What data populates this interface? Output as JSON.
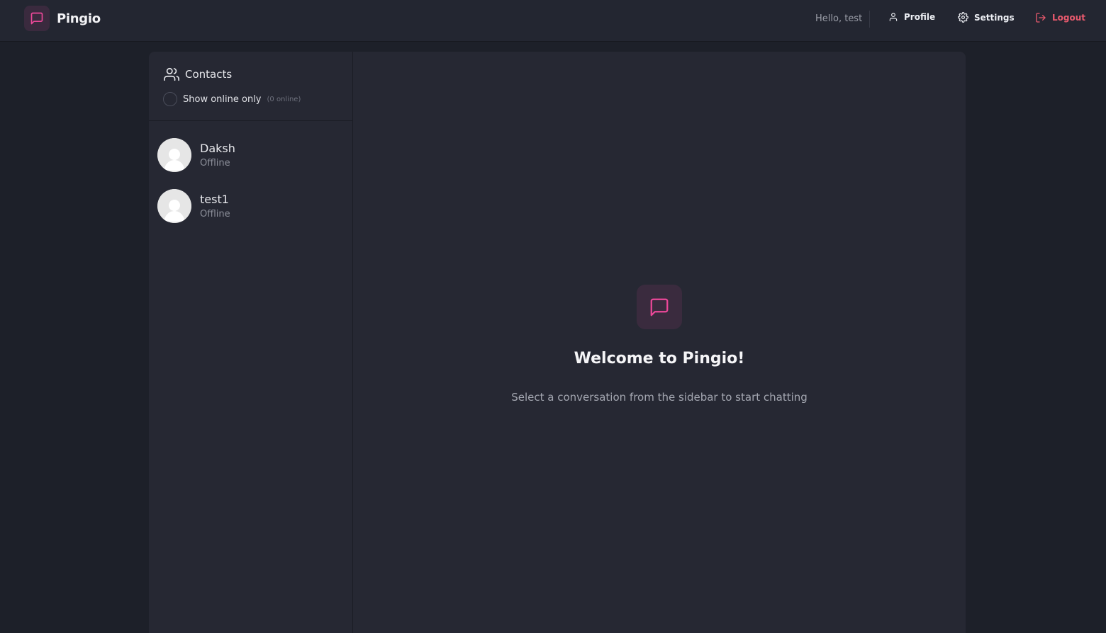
{
  "header": {
    "app_name": "Pingio",
    "greeting": "Hello, test",
    "profile_label": "Profile",
    "settings_label": "Settings",
    "logout_label": "Logout"
  },
  "sidebar": {
    "title": "Contacts",
    "online_filter_label": "Show online only",
    "online_count": "(0 online)",
    "contacts": [
      {
        "name": "Daksh",
        "status": "Offline"
      },
      {
        "name": "test1",
        "status": "Offline"
      }
    ]
  },
  "main": {
    "welcome_title": "Welcome to Pingio!",
    "welcome_subtitle": "Select a conversation from the sidebar to start chatting"
  },
  "colors": {
    "accent": "#ec4899",
    "logout": "#ea5a6e",
    "background": "#1d2029",
    "panel": "#262833"
  }
}
